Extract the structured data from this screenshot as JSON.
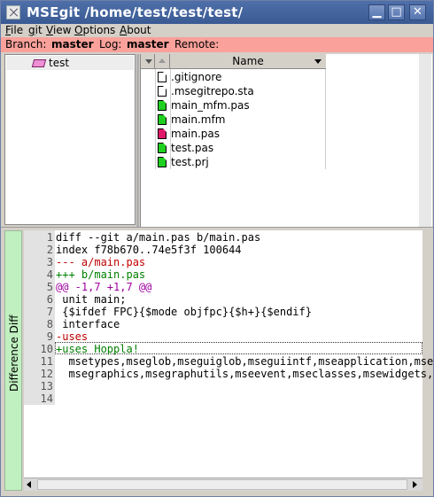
{
  "window": {
    "title": "MSEgit /home/test/test/test/",
    "buttons": {
      "minimize": "▁",
      "maximize": "□",
      "close": "✕"
    }
  },
  "menu": [
    {
      "pre": "",
      "u": "F",
      "post": "ile"
    },
    {
      "pre": "",
      "u": "g",
      "post": "it"
    },
    {
      "pre": "",
      "u": "V",
      "post": "iew"
    },
    {
      "pre": "",
      "u": "O",
      "post": "ptions"
    },
    {
      "pre": "",
      "u": "A",
      "post": "bout"
    }
  ],
  "status": {
    "branch_label": "Branch:",
    "branch_value": "master",
    "log_label": "Log:",
    "log_value": "master",
    "remote_label": "Remote:"
  },
  "tree": {
    "items": [
      "test"
    ]
  },
  "files": {
    "header": "Name",
    "rows": [
      {
        "name": ".gitignore",
        "color": "#ffffff"
      },
      {
        "name": ".msegitrepo.sta",
        "color": "#ffffff"
      },
      {
        "name": "main_mfm.pas",
        "color": "#20d020"
      },
      {
        "name": "main.mfm",
        "color": "#20d020"
      },
      {
        "name": "main.pas",
        "color": "#e0186a"
      },
      {
        "name": "test.pas",
        "color": "#20d020"
      },
      {
        "name": "test.prj",
        "color": "#20d020"
      }
    ]
  },
  "side_tab": {
    "label": "Difference Diff"
  },
  "diff": {
    "lines": [
      {
        "n": "1",
        "text": "diff --git a/main.pas b/main.pas",
        "color": "#000000"
      },
      {
        "n": "2",
        "text": "index f78b670..74e5f3f 100644",
        "color": "#000000"
      },
      {
        "n": "3",
        "text": "--- a/main.pas",
        "color": "#c00000"
      },
      {
        "n": "4",
        "text": "+++ b/main.pas",
        "color": "#008000"
      },
      {
        "n": "5",
        "text": "@@ -1,7 +1,7 @@",
        "color": "#a000a0"
      },
      {
        "n": "6",
        "text": " unit main;",
        "color": "#000000"
      },
      {
        "n": "7",
        "text": " {$ifdef FPC}{$mode objfpc}{$h+}{$endif}",
        "color": "#000000"
      },
      {
        "n": "8",
        "text": " interface",
        "color": "#000000"
      },
      {
        "n": "9",
        "text": "-uses",
        "color": "#c00000"
      },
      {
        "n": "10",
        "text": "+uses Hoppla!",
        "color": "#008000"
      },
      {
        "n": "11",
        "text": "  msetypes,mseglob,mseguiglob,mseguiintf,mseapplication,mse",
        "color": "#000000"
      },
      {
        "n": "12",
        "text": "  msegraphics,msegraphutils,mseevent,mseclasses,msewidgets,",
        "color": "#000000"
      },
      {
        "n": "13",
        "text": "",
        "color": "#000000"
      },
      {
        "n": "14",
        "text": "",
        "color": "#000000"
      }
    ]
  }
}
